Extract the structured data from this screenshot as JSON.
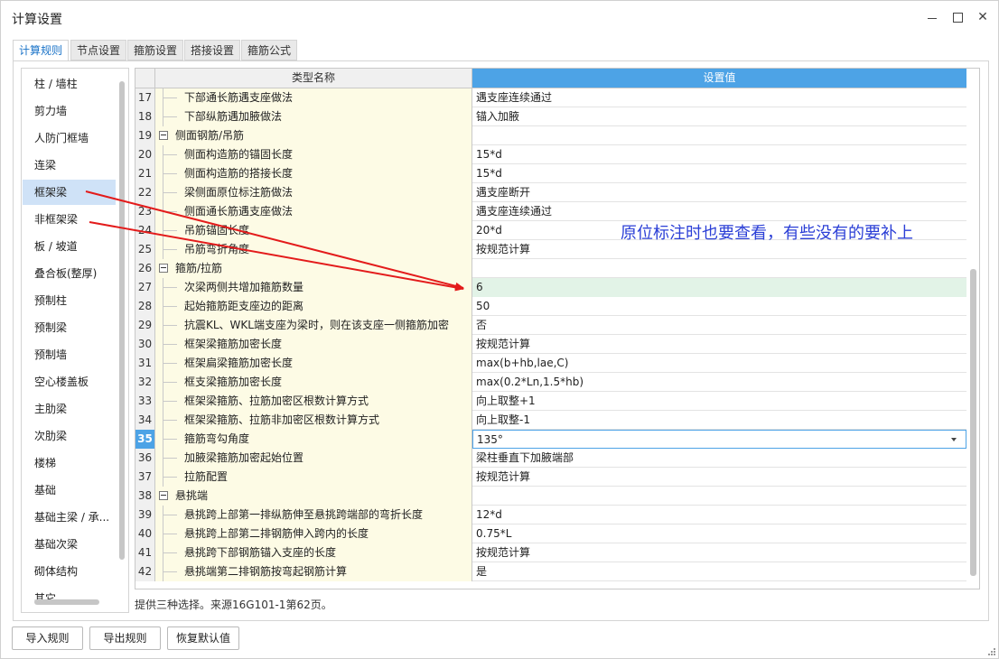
{
  "window": {
    "title": "计算设置",
    "min_icon": "minimize-icon",
    "max_icon": "maximize-icon",
    "close_icon": "close-icon",
    "close_glyph": "✕"
  },
  "tabs": [
    {
      "label": "计算规则",
      "active": true
    },
    {
      "label": "节点设置",
      "active": false
    },
    {
      "label": "箍筋设置",
      "active": false
    },
    {
      "label": "搭接设置",
      "active": false
    },
    {
      "label": "箍筋公式",
      "active": false
    }
  ],
  "sidebar": {
    "selected": "框架梁",
    "items": [
      "柱 / 墙柱",
      "剪力墙",
      "人防门框墙",
      "连梁",
      "框架梁",
      "非框架梁",
      "板 / 坡道",
      "叠合板(整厚)",
      "预制柱",
      "预制梁",
      "预制墙",
      "空心楼盖板",
      "主肋梁",
      "次肋梁",
      "楼梯",
      "基础",
      "基础主梁 / 承...",
      "基础次梁",
      "砌体结构",
      "其它"
    ]
  },
  "grid": {
    "col_name": "类型名称",
    "col_value": "设置值",
    "rows": [
      {
        "num": "17",
        "name": "下部通长筋遇支座做法",
        "value": "遇支座连续通过",
        "kind": "child"
      },
      {
        "num": "18",
        "name": "下部纵筋遇加腋做法",
        "value": "锚入加腋",
        "kind": "child"
      },
      {
        "num": "19",
        "name": "侧面钢筋/吊筋",
        "value": "",
        "kind": "group"
      },
      {
        "num": "20",
        "name": "侧面构造筋的锚固长度",
        "value": "15*d",
        "kind": "child"
      },
      {
        "num": "21",
        "name": "侧面构造筋的搭接长度",
        "value": "15*d",
        "kind": "child"
      },
      {
        "num": "22",
        "name": "梁侧面原位标注筋做法",
        "value": "遇支座断开",
        "kind": "child"
      },
      {
        "num": "23",
        "name": "侧面通长筋遇支座做法",
        "value": "遇支座连续通过",
        "kind": "child"
      },
      {
        "num": "24",
        "name": "吊筋锚固长度",
        "value": "20*d",
        "kind": "child"
      },
      {
        "num": "25",
        "name": "吊筋弯折角度",
        "value": "按规范计算",
        "kind": "child"
      },
      {
        "num": "26",
        "name": "箍筋/拉筋",
        "value": "",
        "kind": "group"
      },
      {
        "num": "27",
        "name": "次梁两侧共增加箍筋数量",
        "value": "6",
        "kind": "child",
        "highlight": true
      },
      {
        "num": "28",
        "name": "起始箍筋距支座边的距离",
        "value": "50",
        "kind": "child"
      },
      {
        "num": "29",
        "name": "抗震KL、WKL端支座为梁时，则在该支座一侧箍筋加密",
        "value": "否",
        "kind": "child"
      },
      {
        "num": "30",
        "name": "框架梁箍筋加密长度",
        "value": "按规范计算",
        "kind": "child"
      },
      {
        "num": "31",
        "name": "框架扁梁箍筋加密长度",
        "value": "max(b+hb,lae,C)",
        "kind": "child"
      },
      {
        "num": "32",
        "name": "框支梁箍筋加密长度",
        "value": "max(0.2*Ln,1.5*hb)",
        "kind": "child"
      },
      {
        "num": "33",
        "name": "框架梁箍筋、拉筋加密区根数计算方式",
        "value": "向上取整+1",
        "kind": "child"
      },
      {
        "num": "34",
        "name": "框架梁箍筋、拉筋非加密区根数计算方式",
        "value": "向上取整-1",
        "kind": "child"
      },
      {
        "num": "35",
        "name": "箍筋弯勾角度",
        "value": "135°",
        "kind": "child",
        "selected": true
      },
      {
        "num": "36",
        "name": "加腋梁箍筋加密起始位置",
        "value": "梁柱垂直下加腋端部",
        "kind": "child"
      },
      {
        "num": "37",
        "name": "拉筋配置",
        "value": "按规范计算",
        "kind": "child"
      },
      {
        "num": "38",
        "name": "悬挑端",
        "value": "",
        "kind": "group"
      },
      {
        "num": "39",
        "name": "悬挑跨上部第一排纵筋伸至悬挑跨端部的弯折长度",
        "value": "12*d",
        "kind": "child"
      },
      {
        "num": "40",
        "name": "悬挑跨上部第二排钢筋伸入跨内的长度",
        "value": "0.75*L",
        "kind": "child"
      },
      {
        "num": "41",
        "name": "悬挑跨下部钢筋锚入支座的长度",
        "value": "按规范计算",
        "kind": "child"
      },
      {
        "num": "42",
        "name": "悬挑端第二排钢筋按弯起钢筋计算",
        "value": "是",
        "kind": "child"
      }
    ]
  },
  "annotation": "原位标注时也要查看，有些没有的要补上",
  "footer_note": "提供三种选择。来源16G101-1第62页。",
  "buttons": {
    "import": "导入规则",
    "export": "导出规则",
    "reset": "恢复默认值"
  },
  "colors": {
    "accent": "#4da3e6",
    "arrow": "#e31b1b",
    "annotation": "#2b3fd6",
    "name_cell_bg": "#fdfbe5",
    "highlight_bg": "#e2f3e7"
  }
}
